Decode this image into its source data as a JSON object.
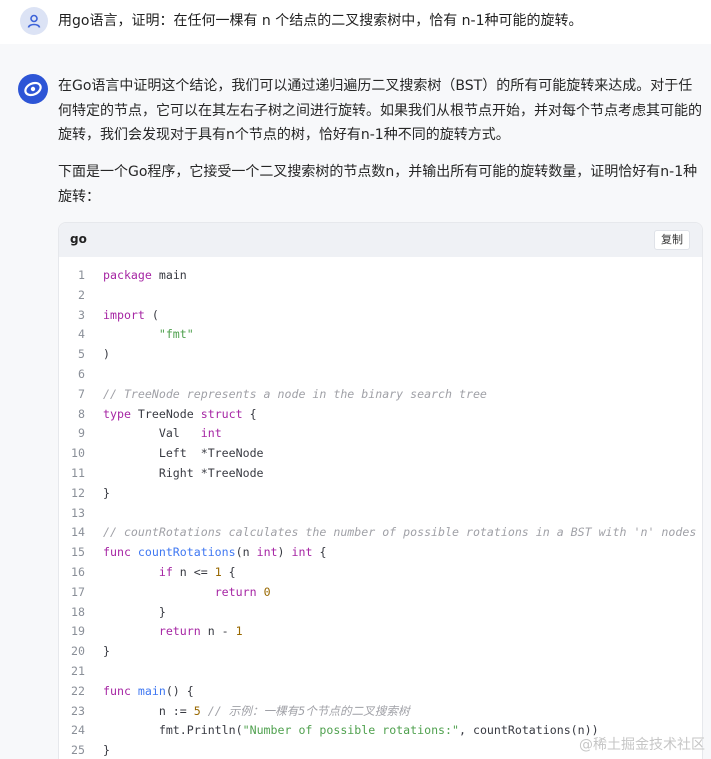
{
  "user_message": {
    "avatar_icon": "user-icon",
    "text": "用go语言，证明：在任何一棵有 n 个结点的二叉搜索树中，恰有 n-1种可能的旋转。"
  },
  "answer": {
    "avatar_icon": "assistant-logo-icon",
    "paragraph1": "在Go语言中证明这个结论，我们可以通过递归遍历二叉搜索树（BST）的所有可能旋转来达成。对于任何特定的节点，它可以在其左右子树之间进行旋转。如果我们从根节点开始，并对每个节点考虑其可能的旋转，我们会发现对于具有n个节点的树，恰好有n-1种不同的旋转方式。",
    "paragraph2": "下面是一个Go程序，它接受一个二叉搜索树的节点数n，并输出所有可能的旋转数量，证明恰好有n-1种旋转："
  },
  "code_block": {
    "language": "go",
    "copy_label": "复制",
    "lines": [
      {
        "n": "1",
        "tokens": [
          [
            "kw",
            "package"
          ],
          [
            "p",
            " main"
          ]
        ]
      },
      {
        "n": "2",
        "tokens": []
      },
      {
        "n": "3",
        "tokens": [
          [
            "kw",
            "import"
          ],
          [
            "p",
            " ("
          ]
        ]
      },
      {
        "n": "4",
        "tokens": [
          [
            "p",
            "        "
          ],
          [
            "str",
            "\"fmt\""
          ]
        ]
      },
      {
        "n": "5",
        "tokens": [
          [
            "p",
            ")"
          ]
        ]
      },
      {
        "n": "6",
        "tokens": []
      },
      {
        "n": "7",
        "tokens": [
          [
            "cmt",
            "// TreeNode represents a node in the binary search tree"
          ]
        ]
      },
      {
        "n": "8",
        "tokens": [
          [
            "kw",
            "type"
          ],
          [
            "p",
            " TreeNode "
          ],
          [
            "kw",
            "struct"
          ],
          [
            "p",
            " {"
          ]
        ]
      },
      {
        "n": "9",
        "tokens": [
          [
            "p",
            "        Val   "
          ],
          [
            "ty",
            "int"
          ]
        ]
      },
      {
        "n": "10",
        "tokens": [
          [
            "p",
            "        Left  *TreeNode"
          ]
        ]
      },
      {
        "n": "11",
        "tokens": [
          [
            "p",
            "        Right *TreeNode"
          ]
        ]
      },
      {
        "n": "12",
        "tokens": [
          [
            "p",
            "}"
          ]
        ]
      },
      {
        "n": "13",
        "tokens": []
      },
      {
        "n": "14",
        "tokens": [
          [
            "cmt",
            "// countRotations calculates the number of possible rotations in a BST with 'n' nodes"
          ]
        ]
      },
      {
        "n": "15",
        "tokens": [
          [
            "kw",
            "func"
          ],
          [
            "p",
            " "
          ],
          [
            "fn",
            "countRotations"
          ],
          [
            "p",
            "(n "
          ],
          [
            "ty",
            "int"
          ],
          [
            "p",
            ") "
          ],
          [
            "ty",
            "int"
          ],
          [
            "p",
            " {"
          ]
        ]
      },
      {
        "n": "16",
        "tokens": [
          [
            "p",
            "        "
          ],
          [
            "kw",
            "if"
          ],
          [
            "p",
            " n <= "
          ],
          [
            "num",
            "1"
          ],
          [
            "p",
            " {"
          ]
        ]
      },
      {
        "n": "17",
        "tokens": [
          [
            "p",
            "                "
          ],
          [
            "kw",
            "return"
          ],
          [
            "p",
            " "
          ],
          [
            "num",
            "0"
          ]
        ]
      },
      {
        "n": "18",
        "tokens": [
          [
            "p",
            "        }"
          ]
        ]
      },
      {
        "n": "19",
        "tokens": [
          [
            "p",
            "        "
          ],
          [
            "kw",
            "return"
          ],
          [
            "p",
            " n - "
          ],
          [
            "num",
            "1"
          ]
        ]
      },
      {
        "n": "20",
        "tokens": [
          [
            "p",
            "}"
          ]
        ]
      },
      {
        "n": "21",
        "tokens": []
      },
      {
        "n": "22",
        "tokens": [
          [
            "kw",
            "func"
          ],
          [
            "p",
            " "
          ],
          [
            "fn",
            "main"
          ],
          [
            "p",
            "() {"
          ]
        ]
      },
      {
        "n": "23",
        "tokens": [
          [
            "p",
            "        n := "
          ],
          [
            "num",
            "5"
          ],
          [
            "p",
            " "
          ],
          [
            "cmt",
            "// 示例：一棵有5个节点的二叉搜索树"
          ]
        ]
      },
      {
        "n": "24",
        "tokens": [
          [
            "p",
            "        fmt.Println("
          ],
          [
            "str",
            "\"Number of possible rotations:\""
          ],
          [
            "p",
            ", countRotations(n))"
          ]
        ]
      },
      {
        "n": "25",
        "tokens": [
          [
            "p",
            "}"
          ]
        ]
      }
    ]
  },
  "watermark": "@稀土掘金技术社区"
}
